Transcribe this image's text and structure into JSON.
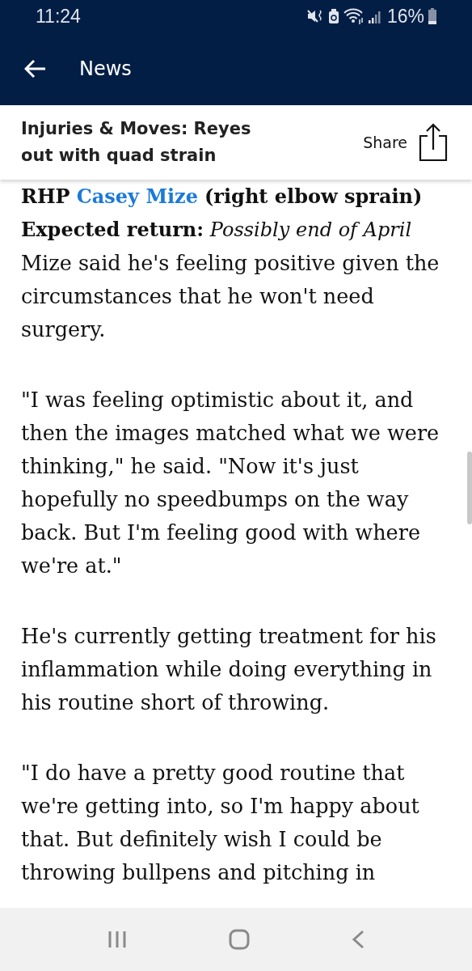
{
  "status_bar": {
    "time": "11:24",
    "battery": "16%"
  },
  "app_bar": {
    "title": "News"
  },
  "article_header": {
    "title": "Injuries & Moves: Reyes out with quad strain",
    "share": "Share"
  },
  "article": {
    "player_line": {
      "prefix": "RHP",
      "link": "Casey Mize",
      "suffix": "(right elbow sprain)"
    },
    "return_line": "**Expected return:** *Possibly end of April*",
    "paragraphs": [
      {
        "text": "Mize said he's feeling positive given the circumstances that he won't need surgery."
      },
      {
        "text": "\"I was feeling optimistic about it, and then the images matched what we were thinking,\" he said. \"Now it's just hopefully no speedbumps on the way back. But I'm feeling good with where we're at.\""
      },
      {
        "text": "He's currently getting treatment for his inflammation while doing everything in his routine short of throwing."
      },
      {
        "text": "\"I do have a pretty good routine that we're getting into, so I'm happy about that. But definitely wish I could be throwing bullpens and pitching in"
      }
    ]
  }
}
